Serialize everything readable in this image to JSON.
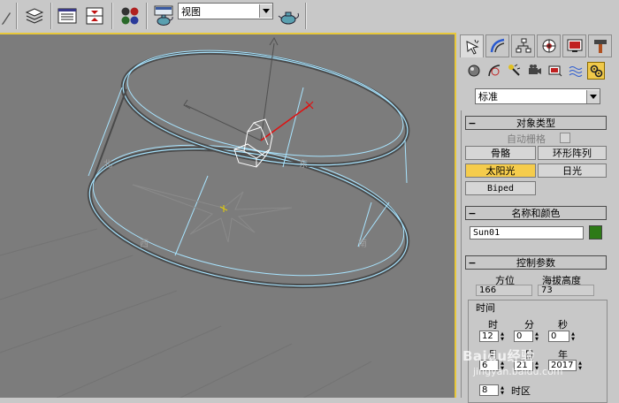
{
  "toolbar": {
    "view_value": "视图",
    "icons": [
      "pencil-icon",
      "layers-icon",
      "track-view-icon",
      "schematic-icon",
      "material-editor-icon",
      "render-setup-icon",
      "quick-render-icon"
    ]
  },
  "viewport": {
    "labels": {
      "north": "北",
      "east": "东",
      "west": "西",
      "south": "南"
    },
    "colors": {
      "background": "#7c7c7c",
      "compass": "#a8e4ff",
      "selection": "#ffffff",
      "axis_x": "#e01010",
      "active_border": "#e8c83a"
    }
  },
  "command_panel": {
    "tabs": [
      "create-tab",
      "modify-tab",
      "hierarchy-tab",
      "motion-tab",
      "display-tab",
      "utilities-tab"
    ],
    "sub_icons": [
      "geometry-icon",
      "shapes-icon",
      "lights-icon",
      "cameras-icon",
      "helpers-icon",
      "space-warps-icon",
      "systems-icon"
    ],
    "category_value": "标准",
    "object_type": {
      "title": "对象类型",
      "autogrid": "自动栅格",
      "buttons": [
        "骨骼",
        "环形阵列",
        "太阳光",
        "日光",
        "Biped"
      ]
    },
    "name_color": {
      "title": "名称和颜色",
      "name": "Sun01",
      "color": "#2d7a16"
    },
    "control": {
      "title": "控制参数",
      "azimuth_label": "方位",
      "azimuth_value": "166",
      "altitude_label": "海拔高度",
      "altitude_value": "73",
      "time_group": "时间",
      "hour_label": "时",
      "hour_value": "12",
      "minute_label": "分",
      "minute_value": "0",
      "second_label": "秒",
      "second_value": "0",
      "month_label": "月",
      "month_value": "6",
      "day_label": "日",
      "day_value": "21",
      "year_label": "年",
      "year_value": "2017",
      "timezone_value": "8",
      "timezone_label": "时区"
    }
  },
  "watermark": {
    "main": "Baidu经验",
    "sub": "jingyan.baidu.com"
  }
}
